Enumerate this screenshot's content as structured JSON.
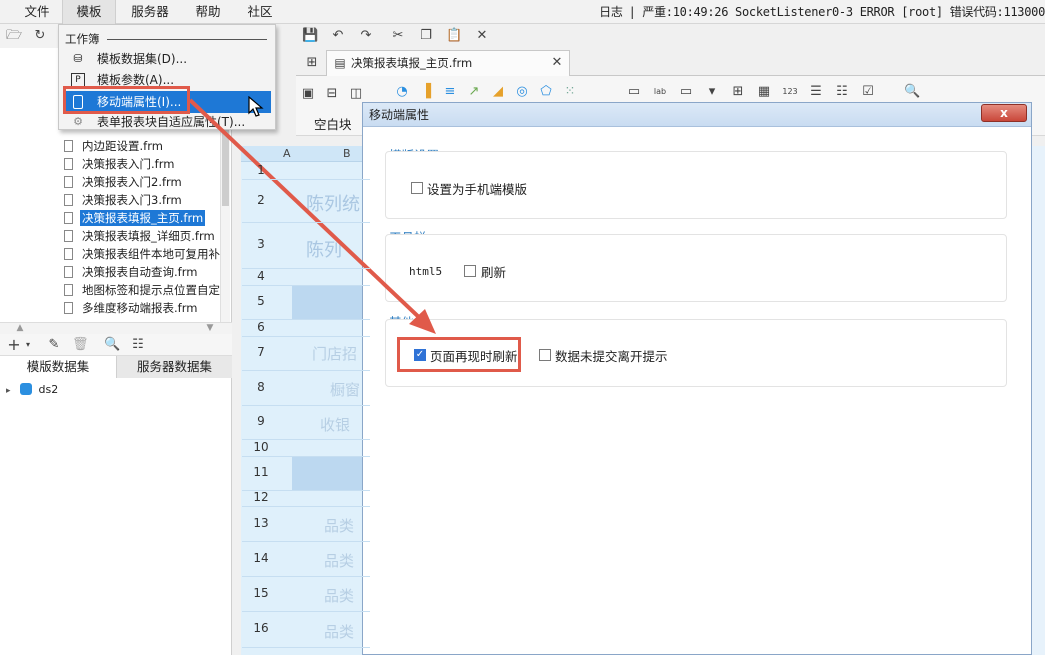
{
  "menubar": {
    "items": [
      "文件",
      "模板",
      "服务器",
      "帮助",
      "社区"
    ],
    "status_log": "日志",
    "status_text": "| 严重:10:49:26 SocketListener0-3 ERROR [root] 错误代码:113000"
  },
  "template_menu": {
    "group_label": "工作簿",
    "items": [
      {
        "label": "模板数据集(D)..."
      },
      {
        "label": "模板参数(A)..."
      },
      {
        "label": "移动端属性(I)..."
      },
      {
        "label": "表单报表块自适应属性(T)..."
      }
    ]
  },
  "file_tree": {
    "items": [
      "内边距设置.frm",
      "决策报表入门.frm",
      "决策报表入门2.frm",
      "决策报表入门3.frm",
      "决策报表填报_主页.frm",
      "决策报表填报_详细页.frm",
      "决策报表组件本地可复用补",
      "决策报表自动查询.frm",
      "地图标签和提示点位置自定",
      "多维度移动端报表.frm"
    ]
  },
  "dataset_panel": {
    "tab_template": "模版数据集",
    "tab_server": "服务器数据集",
    "item": "ds2"
  },
  "editor": {
    "tab_title": "决策报表填报_主页.frm",
    "widget_group_label": "空白块",
    "columns": [
      "A",
      "B"
    ],
    "rows": [
      "1",
      "2",
      "3",
      "4",
      "5",
      "6",
      "7",
      "8",
      "9",
      "10",
      "11",
      "12",
      "13",
      "14",
      "15",
      "16"
    ],
    "cells": {
      "r2": "陈列统",
      "r3": "陈列",
      "r7": "门店招",
      "r8": "橱窗",
      "r9": "收银",
      "r13": "品类",
      "r14": "品类",
      "r15": "品类",
      "r16": "品类"
    }
  },
  "dialog": {
    "title": "移动端属性",
    "close_label": "x",
    "section_template": "模版设置",
    "cb_mobile_template": "设置为手机端模版",
    "section_toolbar": "工具栏",
    "html5_label": "html5",
    "cb_refresh": "刷新",
    "section_other": "其他",
    "cb_page_refresh": "页面再现时刷新",
    "cb_unsubmitted_hint": "数据未提交离开提示",
    "page_refresh_checked": true
  },
  "colors": {
    "highlight": "#1e78d6",
    "section_title": "#2a7bbf",
    "annotation_red": "#e05a4a",
    "checkbox_checked": "#2f72d6"
  }
}
